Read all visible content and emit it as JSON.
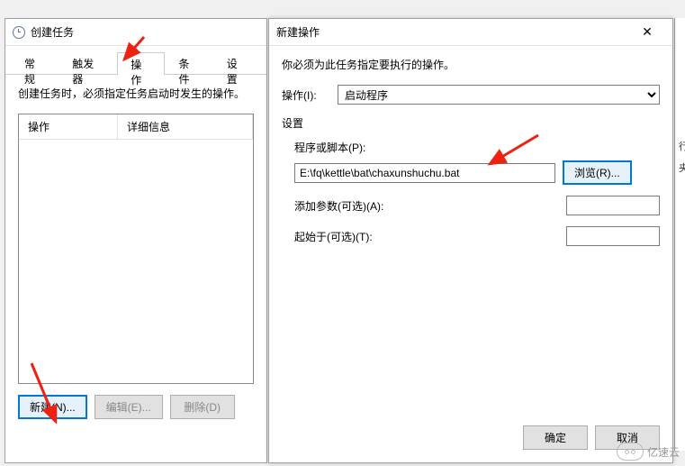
{
  "mainWindow": {
    "title": "创建任务",
    "instruction": "创建任务时，必须指定任务启动时发生的操作。",
    "tabs": [
      "常规",
      "触发器",
      "操作",
      "条件",
      "设置"
    ],
    "activeTab": 2,
    "listColumns": {
      "col1": "操作",
      "col2": "详细信息"
    },
    "buttons": {
      "new": "新建(N)...",
      "edit": "编辑(E)...",
      "delete": "删除(D)"
    }
  },
  "dialog": {
    "title": "新建操作",
    "instruction": "你必须为此任务指定要执行的操作。",
    "actionLabel": "操作(I):",
    "actionValue": "启动程序",
    "settingsLabel": "设置",
    "fields": {
      "pathLabel": "程序或脚本(P):",
      "pathValue": "E:\\fq\\kettle\\bat\\chaxunshuchu.bat",
      "browse": "浏览(R)...",
      "argsLabel": "添加参数(可选)(A):",
      "argsValue": "",
      "startInLabel": "起始于(可选)(T):",
      "startInValue": ""
    },
    "buttons": {
      "ok": "确定",
      "cancel": "取消"
    }
  },
  "sideEdge": {
    "t1": "行",
    "t2": "夹"
  },
  "watermarkText": "亿速云"
}
